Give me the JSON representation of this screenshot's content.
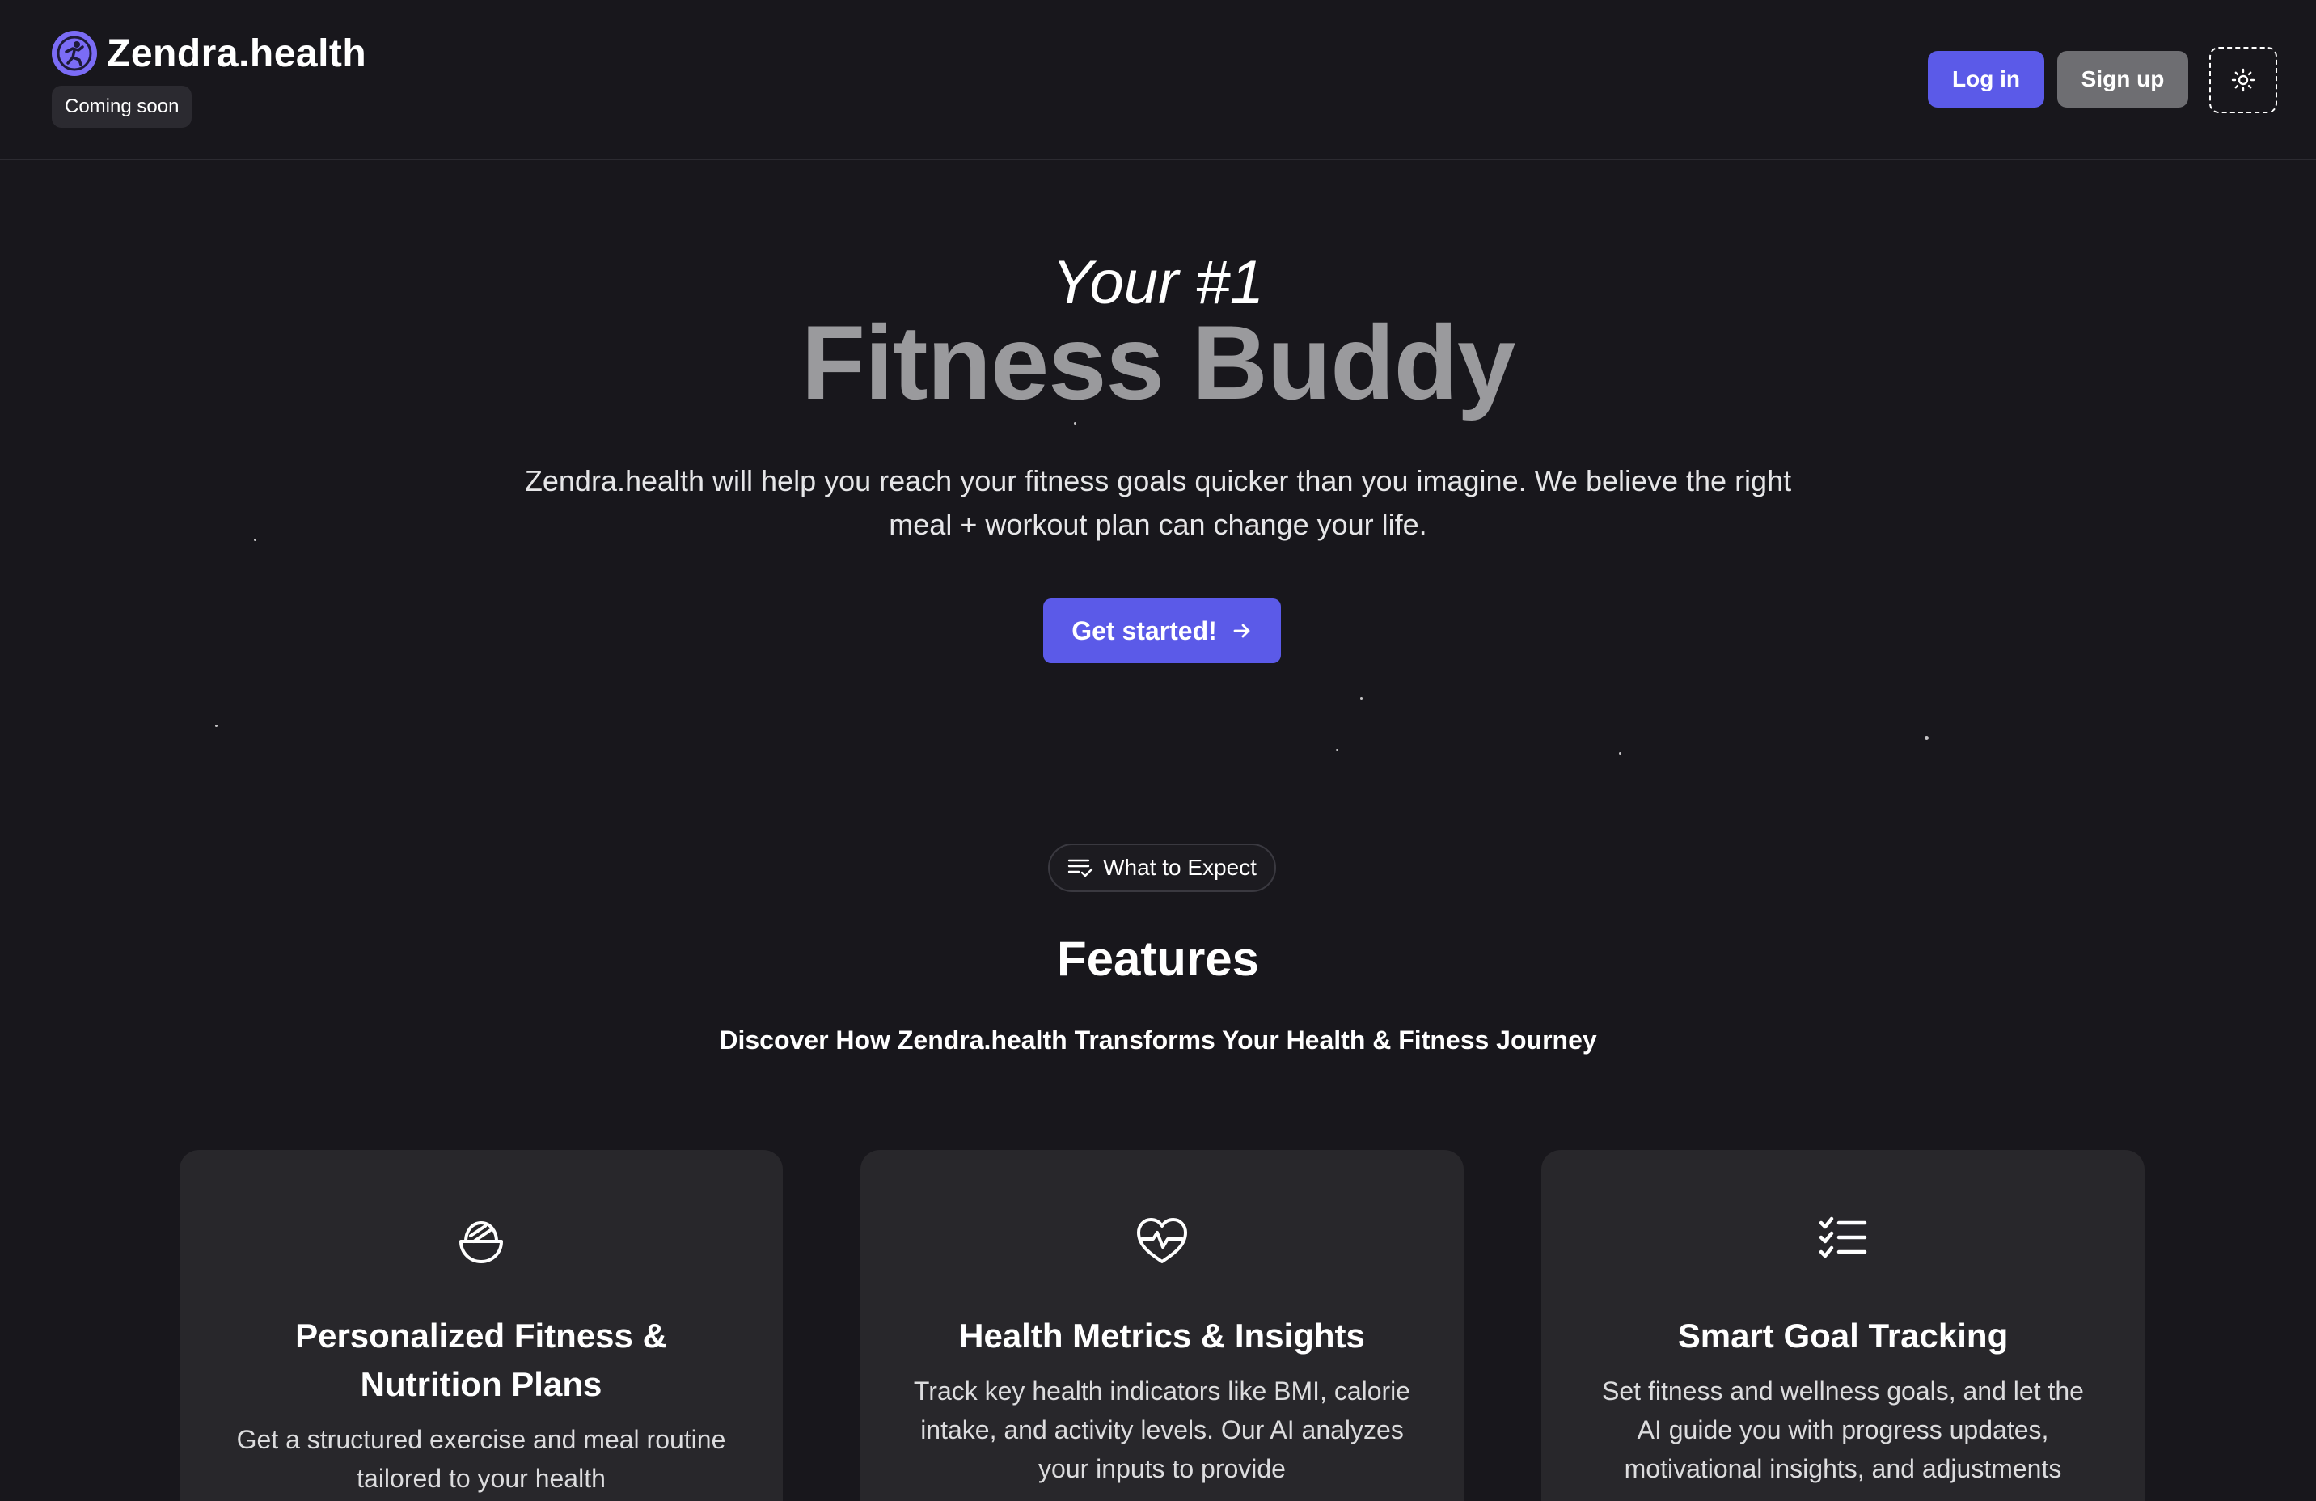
{
  "header": {
    "brand_name": "Zendra.health",
    "badge": "Coming soon",
    "login_label": "Log in",
    "signup_label": "Sign up",
    "theme_icon": "sun-icon"
  },
  "hero": {
    "kicker": "Your #1",
    "title": "Fitness Buddy",
    "description": "Zendra.health will help you reach your fitness goals quicker than you imagine. We believe the right meal + workout plan can change your life.",
    "cta_label": "Get started!",
    "cta_icon": "arrow-right-icon"
  },
  "features": {
    "pill_label": "What to Expect",
    "pill_icon": "list-check-icon",
    "title": "Features",
    "subtitle": "Discover How Zendra.health Transforms Your Health & Fitness Journey",
    "cards": [
      {
        "icon": "bowl-icon",
        "title": "Personalized Fitness & Nutrition Plans",
        "text": "Get a structured exercise and meal routine tailored to your health"
      },
      {
        "icon": "heart-pulse-icon",
        "title": "Health Metrics & Insights",
        "text": "Track key health indicators like BMI, calorie intake, and activity levels. Our AI analyzes your inputs to provide"
      },
      {
        "icon": "checklist-icon",
        "title": "Smart Goal Tracking",
        "text": "Set fitness and wellness goals, and let the AI guide you with progress updates, motivational insights, and adjustments"
      }
    ]
  },
  "colors": {
    "background": "#18171c",
    "accent": "#5b5ae8",
    "card": "#28272b",
    "muted_title": "#9a9a9d"
  }
}
